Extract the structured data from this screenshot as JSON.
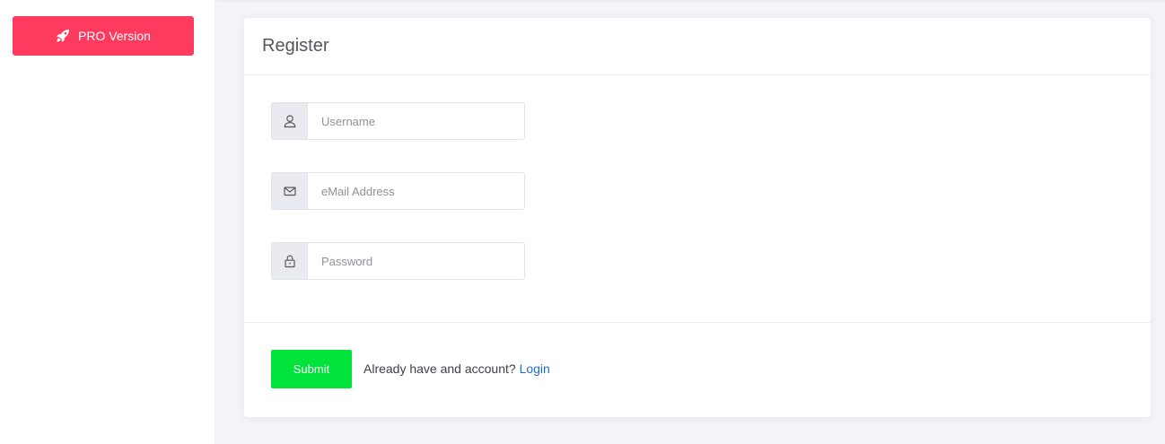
{
  "sidebar": {
    "pro_button": {
      "label": "PRO Version",
      "icon": "rocket-icon",
      "color": "#fe3b5e"
    }
  },
  "card": {
    "title": "Register",
    "fields": [
      {
        "icon": "user-icon",
        "placeholder": "Username",
        "value": ""
      },
      {
        "icon": "mail-icon",
        "placeholder": "eMail Address",
        "value": ""
      },
      {
        "icon": "lock-icon",
        "placeholder": "Password",
        "value": ""
      }
    ],
    "footer": {
      "submit_label": "Submit",
      "submit_color": "#00e33a",
      "prompt_text": "Already have and account?",
      "login_label": "Login",
      "login_color": "#1b6ecf"
    }
  }
}
